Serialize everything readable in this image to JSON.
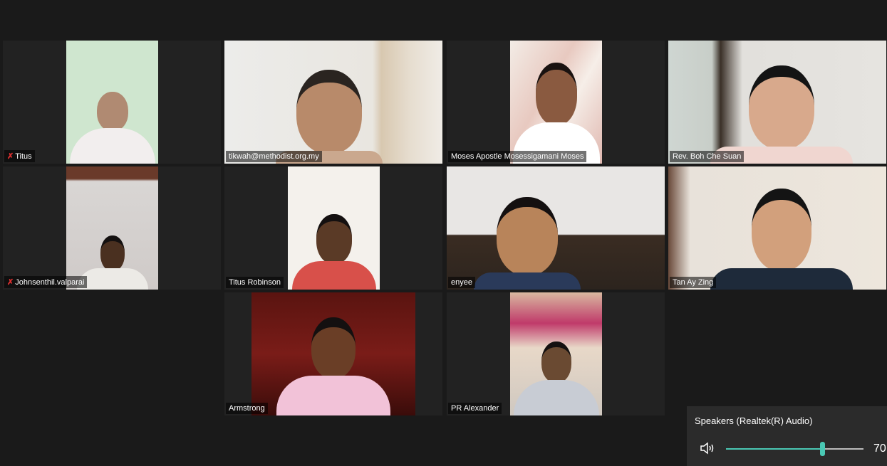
{
  "participants": [
    {
      "name": "Titus",
      "muted": true
    },
    {
      "name": "tikwah@methodist.org.my",
      "muted": false
    },
    {
      "name": "Moses Apostle Mosessigamani Moses",
      "muted": false
    },
    {
      "name": "Rev. Boh Che Suan",
      "muted": false
    },
    {
      "name": "Johnsenthil.valparai",
      "muted": true
    },
    {
      "name": "Titus Robinson",
      "muted": false
    },
    {
      "name": "enyee",
      "muted": false
    },
    {
      "name": "Tan Ay Zing",
      "muted": false,
      "active_speaker": true
    },
    {
      "name": "Armstrong",
      "muted": false
    },
    {
      "name": "PR Alexander",
      "muted": false
    }
  ],
  "audio": {
    "device": "Speakers (Realtek(R) Audio)",
    "volume_label": "70",
    "volume_fraction": 0.7,
    "icon": "speaker-icon"
  },
  "colors": {
    "background": "#1a1a1a",
    "tile": "#222222",
    "active_border": "#d8e04a",
    "slider_accent": "#4ac8b4",
    "muted_icon": "#e03030"
  }
}
